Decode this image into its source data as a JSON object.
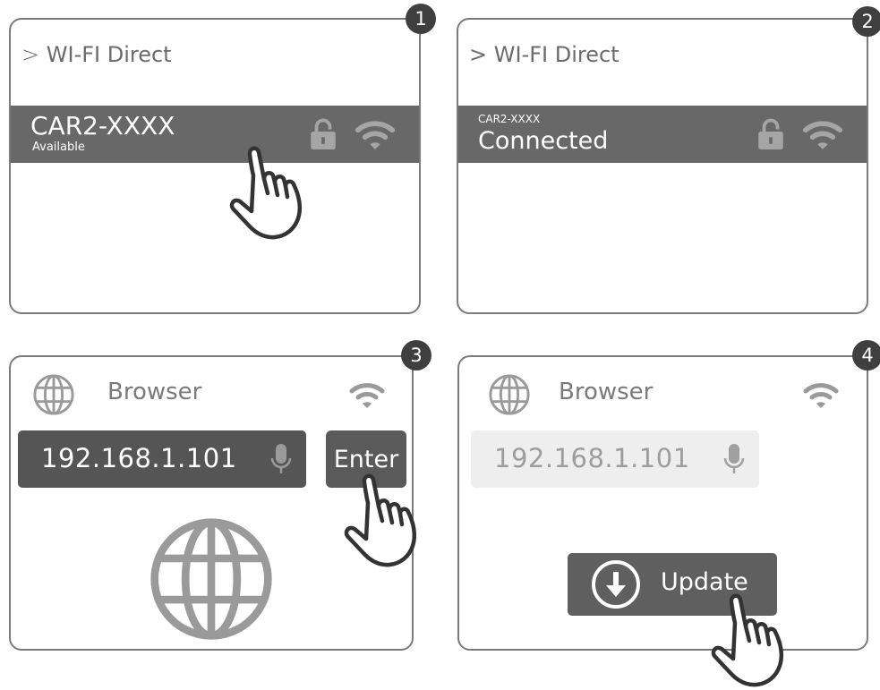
{
  "panel1": {
    "step": "1",
    "header": "WI-FI Direct",
    "network_name": "CAR2-XXXX",
    "network_status": "Available"
  },
  "panel2": {
    "step": "2",
    "header": "WI-FI Direct",
    "network_name": "CAR2-XXXX",
    "network_status": "Connected"
  },
  "panel3": {
    "step": "3",
    "title": "Browser",
    "url": "192.168.1.101",
    "enter_label": "Enter"
  },
  "panel4": {
    "step": "4",
    "title": "Browser",
    "url": "192.168.1.101",
    "update_label": "Update"
  },
  "colors": {
    "panel_border": "#7b7b7b",
    "row_dark": "#686868",
    "badge": "#3f3f3f",
    "icon_gray": "#9a9a9a"
  }
}
